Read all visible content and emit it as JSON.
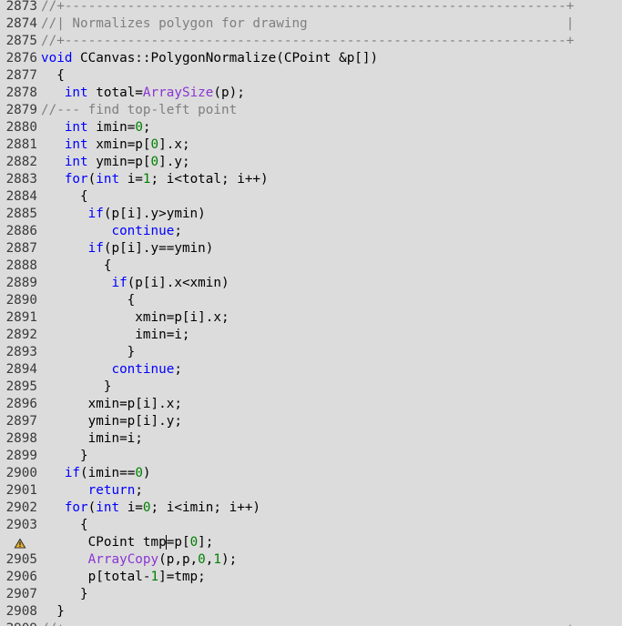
{
  "editor": {
    "lines": [
      {
        "num": "2873",
        "tokens": [
          {
            "t": "cm",
            "v": "//+----------------------------------------------------------------+"
          }
        ]
      },
      {
        "num": "2874",
        "tokens": [
          {
            "t": "cm",
            "v": "//| Normalizes polygon for drawing                                 |"
          }
        ]
      },
      {
        "num": "2875",
        "tokens": [
          {
            "t": "cm",
            "v": "//+----------------------------------------------------------------+"
          }
        ]
      },
      {
        "num": "2876",
        "tokens": [
          {
            "t": "kw",
            "v": "void"
          },
          {
            "t": "tx",
            "v": " CCanvas::PolygonNormalize(CPoint &p[])"
          }
        ]
      },
      {
        "num": "2877",
        "tokens": [
          {
            "t": "tx",
            "v": "  {"
          }
        ]
      },
      {
        "num": "2878",
        "tokens": [
          {
            "t": "tx",
            "v": "   "
          },
          {
            "t": "kw",
            "v": "int"
          },
          {
            "t": "tx",
            "v": " total="
          },
          {
            "t": "fn",
            "v": "ArraySize"
          },
          {
            "t": "tx",
            "v": "(p);"
          }
        ]
      },
      {
        "num": "2879",
        "tokens": [
          {
            "t": "cm",
            "v": "//--- find top-left point"
          }
        ]
      },
      {
        "num": "2880",
        "tokens": [
          {
            "t": "tx",
            "v": "   "
          },
          {
            "t": "kw",
            "v": "int"
          },
          {
            "t": "tx",
            "v": " imin="
          },
          {
            "t": "nm",
            "v": "0"
          },
          {
            "t": "tx",
            "v": ";"
          }
        ]
      },
      {
        "num": "2881",
        "tokens": [
          {
            "t": "tx",
            "v": "   "
          },
          {
            "t": "kw",
            "v": "int"
          },
          {
            "t": "tx",
            "v": " xmin=p["
          },
          {
            "t": "nm",
            "v": "0"
          },
          {
            "t": "tx",
            "v": "].x;"
          }
        ]
      },
      {
        "num": "2882",
        "tokens": [
          {
            "t": "tx",
            "v": "   "
          },
          {
            "t": "kw",
            "v": "int"
          },
          {
            "t": "tx",
            "v": " ymin=p["
          },
          {
            "t": "nm",
            "v": "0"
          },
          {
            "t": "tx",
            "v": "].y;"
          }
        ]
      },
      {
        "num": "2883",
        "tokens": [
          {
            "t": "tx",
            "v": "   "
          },
          {
            "t": "kw",
            "v": "for"
          },
          {
            "t": "tx",
            "v": "("
          },
          {
            "t": "kw",
            "v": "int"
          },
          {
            "t": "tx",
            "v": " i="
          },
          {
            "t": "nm",
            "v": "1"
          },
          {
            "t": "tx",
            "v": "; i<total; i++)"
          }
        ]
      },
      {
        "num": "2884",
        "tokens": [
          {
            "t": "tx",
            "v": "     {"
          }
        ]
      },
      {
        "num": "2885",
        "tokens": [
          {
            "t": "tx",
            "v": "      "
          },
          {
            "t": "kw",
            "v": "if"
          },
          {
            "t": "tx",
            "v": "(p[i].y>ymin)"
          }
        ]
      },
      {
        "num": "2886",
        "tokens": [
          {
            "t": "tx",
            "v": "         "
          },
          {
            "t": "kw",
            "v": "continue"
          },
          {
            "t": "tx",
            "v": ";"
          }
        ]
      },
      {
        "num": "2887",
        "tokens": [
          {
            "t": "tx",
            "v": "      "
          },
          {
            "t": "kw",
            "v": "if"
          },
          {
            "t": "tx",
            "v": "(p[i].y==ymin)"
          }
        ]
      },
      {
        "num": "2888",
        "tokens": [
          {
            "t": "tx",
            "v": "        {"
          }
        ]
      },
      {
        "num": "2889",
        "tokens": [
          {
            "t": "tx",
            "v": "         "
          },
          {
            "t": "kw",
            "v": "if"
          },
          {
            "t": "tx",
            "v": "(p[i].x<xmin)"
          }
        ]
      },
      {
        "num": "2890",
        "tokens": [
          {
            "t": "tx",
            "v": "           {"
          }
        ]
      },
      {
        "num": "2891",
        "tokens": [
          {
            "t": "tx",
            "v": "            xmin=p[i].x;"
          }
        ]
      },
      {
        "num": "2892",
        "tokens": [
          {
            "t": "tx",
            "v": "            imin=i;"
          }
        ]
      },
      {
        "num": "2893",
        "tokens": [
          {
            "t": "tx",
            "v": "           }"
          }
        ]
      },
      {
        "num": "2894",
        "tokens": [
          {
            "t": "tx",
            "v": "         "
          },
          {
            "t": "kw",
            "v": "continue"
          },
          {
            "t": "tx",
            "v": ";"
          }
        ]
      },
      {
        "num": "2895",
        "tokens": [
          {
            "t": "tx",
            "v": "        }"
          }
        ]
      },
      {
        "num": "2896",
        "tokens": [
          {
            "t": "tx",
            "v": "      xmin=p[i].x;"
          }
        ]
      },
      {
        "num": "2897",
        "tokens": [
          {
            "t": "tx",
            "v": "      ymin=p[i].y;"
          }
        ]
      },
      {
        "num": "2898",
        "tokens": [
          {
            "t": "tx",
            "v": "      imin=i;"
          }
        ]
      },
      {
        "num": "2899",
        "tokens": [
          {
            "t": "tx",
            "v": "     }"
          }
        ]
      },
      {
        "num": "2900",
        "tokens": [
          {
            "t": "tx",
            "v": "   "
          },
          {
            "t": "kw",
            "v": "if"
          },
          {
            "t": "tx",
            "v": "(imin=="
          },
          {
            "t": "nm",
            "v": "0"
          },
          {
            "t": "tx",
            "v": ")"
          }
        ]
      },
      {
        "num": "2901",
        "tokens": [
          {
            "t": "tx",
            "v": "      "
          },
          {
            "t": "kw",
            "v": "return"
          },
          {
            "t": "tx",
            "v": ";"
          }
        ]
      },
      {
        "num": "2902",
        "tokens": [
          {
            "t": "tx",
            "v": "   "
          },
          {
            "t": "kw",
            "v": "for"
          },
          {
            "t": "tx",
            "v": "("
          },
          {
            "t": "kw",
            "v": "int"
          },
          {
            "t": "tx",
            "v": " i="
          },
          {
            "t": "nm",
            "v": "0"
          },
          {
            "t": "tx",
            "v": "; i<imin; i++)"
          }
        ]
      },
      {
        "num": "2903",
        "tokens": [
          {
            "t": "tx",
            "v": "     {"
          }
        ]
      },
      {
        "num": "",
        "warning": true,
        "caret_after": 2,
        "tokens": [
          {
            "t": "tx",
            "v": "      CPoint tmp"
          },
          {
            "t": "tx",
            "v": "=p["
          },
          {
            "t": "nm",
            "v": "0"
          },
          {
            "t": "tx",
            "v": "];"
          }
        ]
      },
      {
        "num": "2905",
        "tokens": [
          {
            "t": "tx",
            "v": "      "
          },
          {
            "t": "fn",
            "v": "ArrayCopy"
          },
          {
            "t": "tx",
            "v": "(p,p,"
          },
          {
            "t": "nm",
            "v": "0"
          },
          {
            "t": "tx",
            "v": ","
          },
          {
            "t": "nm",
            "v": "1"
          },
          {
            "t": "tx",
            "v": ");"
          }
        ]
      },
      {
        "num": "2906",
        "tokens": [
          {
            "t": "tx",
            "v": "      p[total-"
          },
          {
            "t": "nm",
            "v": "1"
          },
          {
            "t": "tx",
            "v": "]=tmp;"
          }
        ]
      },
      {
        "num": "2907",
        "tokens": [
          {
            "t": "tx",
            "v": "     }"
          }
        ]
      },
      {
        "num": "2908",
        "tokens": [
          {
            "t": "tx",
            "v": "  }"
          }
        ]
      },
      {
        "num": "2909",
        "tokens": [
          {
            "t": "cm",
            "v": "//+----------------------------------------------------------------+"
          }
        ]
      }
    ]
  }
}
